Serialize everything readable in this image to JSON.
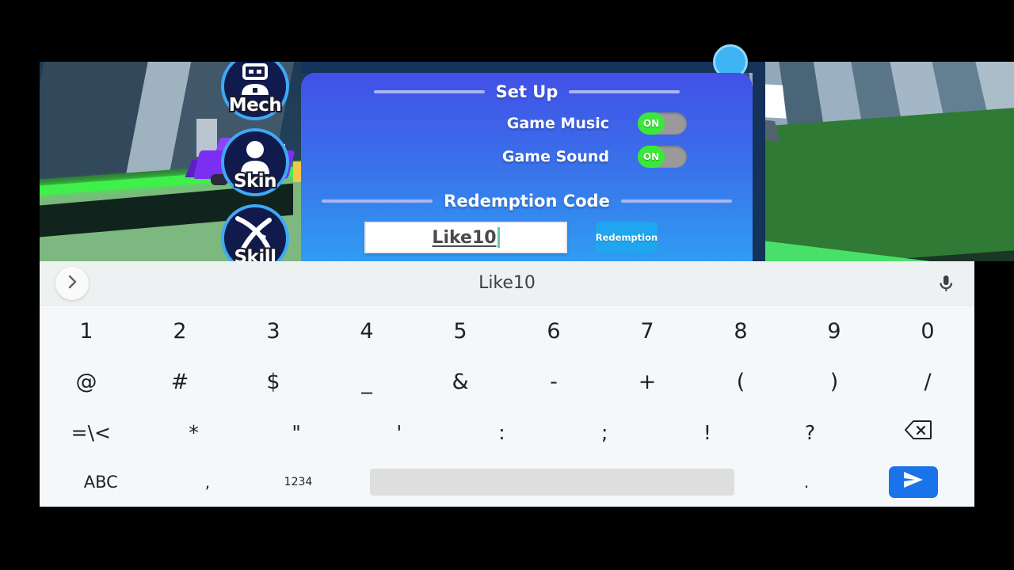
{
  "game": {
    "side_buttons": [
      {
        "label": "Mech",
        "icon": "robot-icon"
      },
      {
        "label": "Skin",
        "icon": "person-icon"
      },
      {
        "label": "Skill",
        "icon": "slash-icon"
      }
    ]
  },
  "panel": {
    "title": "Set Up",
    "settings": [
      {
        "label": "Game Music",
        "state": "ON"
      },
      {
        "label": "Game Sound",
        "state": "ON"
      }
    ],
    "code_section_title": "Redemption Code",
    "code_value": "Like10",
    "redeem_button": "Redemption",
    "accent_blue": "#1fa6ef",
    "toggle_on_color": "#3ae83a",
    "toggle_track_color": "#9a9a9a"
  },
  "keyboard": {
    "suggestion": "Like10",
    "expand_icon": "chevron-right-icon",
    "mic_icon": "microphone-icon",
    "row1": [
      "1",
      "2",
      "3",
      "4",
      "5",
      "6",
      "7",
      "8",
      "9",
      "0"
    ],
    "row2": [
      "@",
      "#",
      "$",
      "_",
      "&",
      "-",
      "+",
      "(",
      ")",
      "/"
    ],
    "row3": [
      "=\\<",
      "*",
      "\"",
      "'",
      ":",
      ";",
      "!",
      "?"
    ],
    "row3_backspace_icon": "backspace-icon",
    "row4": {
      "abc": "ABC",
      "comma": ",",
      "numeric": "12\n34",
      "numeric_line1": "12",
      "numeric_line2": "34",
      "space": "",
      "period": ".",
      "send_icon": "send-icon"
    },
    "send_button_color": "#1a73e8",
    "background": "#f4f8fa",
    "suggestion_background": "#eef1f2"
  }
}
